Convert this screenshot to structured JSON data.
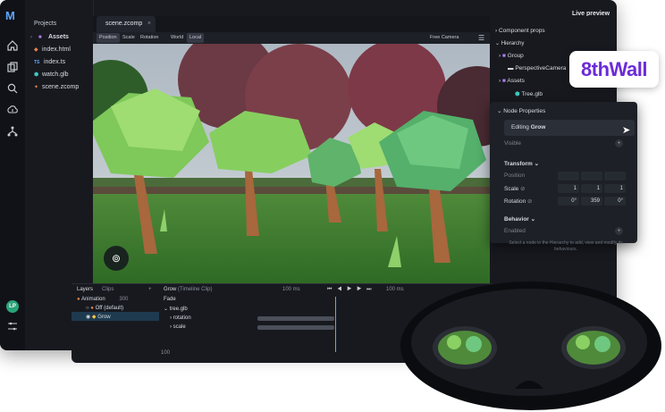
{
  "rail": {
    "logo": "M",
    "avatar": "LP"
  },
  "files": {
    "header": "Projects",
    "items": [
      {
        "icon": "folder",
        "label": "Assets"
      },
      {
        "icon": "html",
        "label": "index.html"
      },
      {
        "icon": "ts",
        "label": "index.ts"
      },
      {
        "icon": "glb",
        "label": "watch.glb"
      },
      {
        "icon": "zcomp",
        "label": "scene.zcomp"
      }
    ],
    "ts_prefix": "TS"
  },
  "editor": {
    "tab_label": "scene.zcomp",
    "tools": [
      "Position",
      "Scale",
      "Rotation"
    ],
    "space": [
      "World",
      "Local"
    ],
    "camera": "Free Camera"
  },
  "right": {
    "live_preview": "Live preview",
    "component_props": "Component props",
    "hierarchy": "Hierarchy",
    "tree": [
      "Group",
      "PerspectiveCamera",
      "Assets",
      "Tree.glb"
    ]
  },
  "badge": {
    "text": "8thWall"
  },
  "node": {
    "title": "Node Properties",
    "editing_prefix": "Editing",
    "editing_name": "Grow",
    "visible": "Visible",
    "transform": "Transform",
    "position": "Position",
    "scale": "Scale",
    "rotation": "Rotation",
    "scale_values": [
      "1",
      "1",
      "1"
    ],
    "rotation_values": [
      "0°",
      "359",
      "0°"
    ],
    "behavior": "Behavior",
    "enabled": "Enabled",
    "hint": "Select a node in the Hierarchy to add, view and modify its behaviours."
  },
  "timeline": {
    "tabs": [
      "Layers",
      "Clips"
    ],
    "clip_title": "Grow",
    "clip_subtitle": "(Timeline Clip)",
    "animation_label": "Animation",
    "animation_value": "300",
    "off_label": "Off (default)",
    "grow_label": "Grow",
    "fade": "Fade",
    "duration_1": "100 ms",
    "duration_2": "100 ms",
    "tracks": [
      "tree.glb",
      "rotation",
      "scale"
    ],
    "footer_value": "100"
  },
  "colors": {
    "accent": "#5ea6ff",
    "brand": "#6c2bd9",
    "panel": "#17191f",
    "selection": "#1e3a4f"
  }
}
